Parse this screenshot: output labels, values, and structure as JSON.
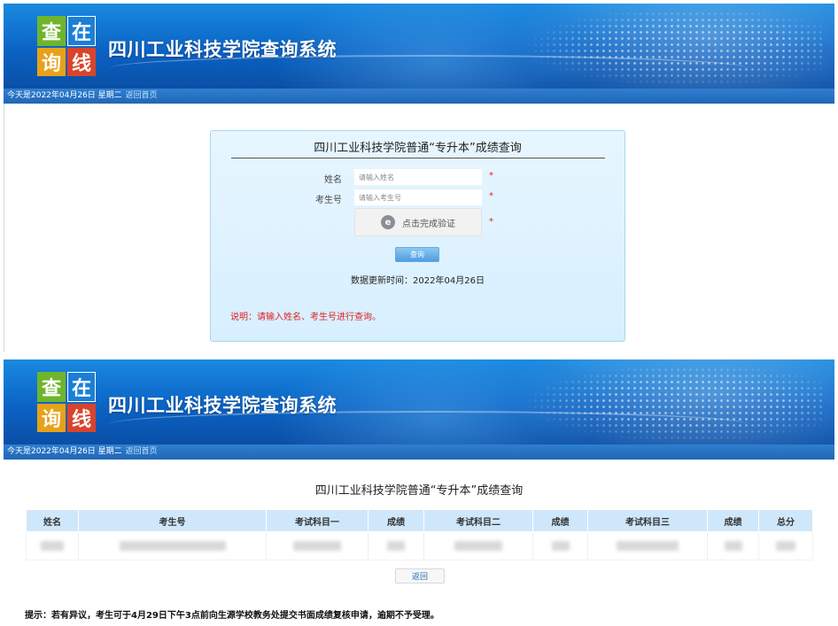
{
  "header": {
    "logo_chars": [
      "查",
      "在",
      "询",
      "线"
    ],
    "site_title": "四川工业科技学院查询系统",
    "date_text": "今天是2022年04月26日 星期二",
    "home_link": "返回首页"
  },
  "query_form": {
    "title": "四川工业科技学院普通“专升本”成绩查询",
    "name_label": "姓名",
    "name_placeholder": "请输入姓名",
    "exam_id_label": "考生号",
    "exam_id_placeholder": "请输入考生号",
    "required_mark": "*",
    "captcha_icon_text": "e",
    "captcha_text": "点击完成验证",
    "submit_label": "查询",
    "update_time": "数据更新时间：2022年04月26日",
    "note": "说明：请输入姓名、考生号进行查询。"
  },
  "results": {
    "title": "四川工业科技学院普通“专升本”成绩查询",
    "columns": [
      "姓名",
      "考生号",
      "考试科目一",
      "成绩",
      "考试科目二",
      "成绩",
      "考试科目三",
      "成绩",
      "总分"
    ],
    "back_label": "返回",
    "tip": "提示：若有异议，考生可于4月29日下午3点前向生源学校教务处提交书面成绩复核申请，逾期不予受理。"
  },
  "colors": {
    "banner_blue": "#0b63c4",
    "header_row": "#cfe7fb",
    "accent_red": "#e02020"
  }
}
